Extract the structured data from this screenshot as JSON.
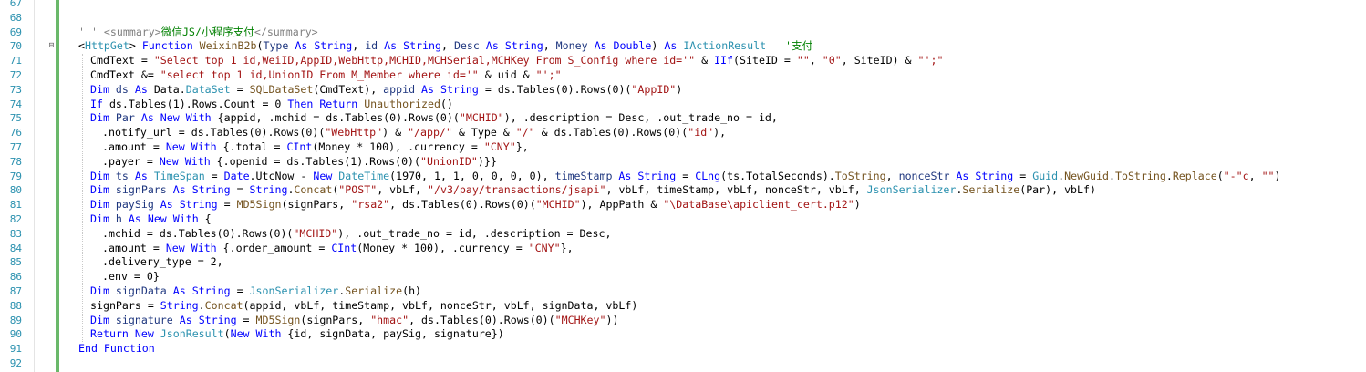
{
  "editor": {
    "colors": {
      "keyword": "#0000ff",
      "string": "#a31515",
      "type": "#2b91af",
      "comment": "#008000",
      "doc_comment": "#808080",
      "plain": "#000000",
      "method": "#74531f",
      "line_number": "#2b91af",
      "change_bar": "#6ab86a"
    },
    "fold_markers": [
      {
        "line": 70,
        "icon": "fold-collapse-icon",
        "glyph": "⊟"
      }
    ],
    "lines": [
      {
        "number": "67",
        "indent": 0,
        "tokens": []
      },
      {
        "number": "68",
        "indent": 0,
        "tokens": []
      },
      {
        "number": "69",
        "indent": 0,
        "tokens": [
          {
            "t": "''' ",
            "c": "doc"
          },
          {
            "t": "<summary>",
            "c": "doc"
          },
          {
            "t": "微信JS/小程序支付",
            "c": "cmt"
          },
          {
            "t": "</summary>",
            "c": "doc"
          }
        ]
      },
      {
        "number": "70",
        "indent": 0,
        "tokens": [
          {
            "t": "<",
            "c": "plain"
          },
          {
            "t": "HttpGet",
            "c": "type"
          },
          {
            "t": "> ",
            "c": "plain"
          },
          {
            "t": "Function ",
            "c": "kw"
          },
          {
            "t": "WeixinB2b",
            "c": "fn"
          },
          {
            "t": "(",
            "c": "plain"
          },
          {
            "t": "Type ",
            "c": "var"
          },
          {
            "t": "As ",
            "c": "kw"
          },
          {
            "t": "String",
            "c": "kw"
          },
          {
            "t": ", ",
            "c": "plain"
          },
          {
            "t": "id ",
            "c": "var"
          },
          {
            "t": "As ",
            "c": "kw"
          },
          {
            "t": "String",
            "c": "kw"
          },
          {
            "t": ", ",
            "c": "plain"
          },
          {
            "t": "Desc ",
            "c": "var"
          },
          {
            "t": "As ",
            "c": "kw"
          },
          {
            "t": "String",
            "c": "kw"
          },
          {
            "t": ", ",
            "c": "plain"
          },
          {
            "t": "Money ",
            "c": "var"
          },
          {
            "t": "As ",
            "c": "kw"
          },
          {
            "t": "Double",
            "c": "kw"
          },
          {
            "t": ") ",
            "c": "plain"
          },
          {
            "t": "As ",
            "c": "kw"
          },
          {
            "t": "IActionResult",
            "c": "type"
          },
          {
            "t": "   '支付",
            "c": "cmt"
          }
        ]
      },
      {
        "number": "71",
        "indent": 1,
        "tokens": [
          {
            "t": "CmdText = ",
            "c": "plain"
          },
          {
            "t": "\"Select top 1 id,WeiID,AppID,WebHttp,MCHID,MCHSerial,MCHKey From S_Config where id='\"",
            "c": "str"
          },
          {
            "t": " & ",
            "c": "plain"
          },
          {
            "t": "IIf",
            "c": "kw"
          },
          {
            "t": "(SiteID = ",
            "c": "plain"
          },
          {
            "t": "\"\"",
            "c": "str"
          },
          {
            "t": ", ",
            "c": "plain"
          },
          {
            "t": "\"0\"",
            "c": "str"
          },
          {
            "t": ", SiteID) & ",
            "c": "plain"
          },
          {
            "t": "\"';\"",
            "c": "str"
          }
        ]
      },
      {
        "number": "72",
        "indent": 1,
        "tokens": [
          {
            "t": "CmdText &= ",
            "c": "plain"
          },
          {
            "t": "\"select top 1 id,UnionID From M_Member where id='\"",
            "c": "str"
          },
          {
            "t": " & uid & ",
            "c": "plain"
          },
          {
            "t": "\"';\"",
            "c": "str"
          }
        ]
      },
      {
        "number": "73",
        "indent": 1,
        "tokens": [
          {
            "t": "Dim ",
            "c": "kw"
          },
          {
            "t": "ds ",
            "c": "var"
          },
          {
            "t": "As ",
            "c": "kw"
          },
          {
            "t": "Data",
            "c": "plain"
          },
          {
            "t": ".",
            "c": "plain"
          },
          {
            "t": "DataSet",
            "c": "type"
          },
          {
            "t": " = ",
            "c": "plain"
          },
          {
            "t": "SQLDataSet",
            "c": "fn"
          },
          {
            "t": "(CmdText), ",
            "c": "plain"
          },
          {
            "t": "appid ",
            "c": "var"
          },
          {
            "t": "As ",
            "c": "kw"
          },
          {
            "t": "String",
            "c": "kw"
          },
          {
            "t": " = ds.Tables(0).Rows(0)(",
            "c": "plain"
          },
          {
            "t": "\"AppID\"",
            "c": "str"
          },
          {
            "t": ")",
            "c": "plain"
          }
        ]
      },
      {
        "number": "74",
        "indent": 1,
        "tokens": [
          {
            "t": "If ",
            "c": "kw"
          },
          {
            "t": "ds.Tables(1).Rows.Count = 0 ",
            "c": "plain"
          },
          {
            "t": "Then ",
            "c": "kw"
          },
          {
            "t": "Return ",
            "c": "kw"
          },
          {
            "t": "Unauthorized",
            "c": "fn"
          },
          {
            "t": "()",
            "c": "plain"
          }
        ]
      },
      {
        "number": "75",
        "indent": 1,
        "tokens": [
          {
            "t": "Dim ",
            "c": "kw"
          },
          {
            "t": "Par ",
            "c": "var"
          },
          {
            "t": "As ",
            "c": "kw"
          },
          {
            "t": "New ",
            "c": "kw"
          },
          {
            "t": "With ",
            "c": "kw"
          },
          {
            "t": "{appid, .mchid = ds.Tables(0).Rows(0)(",
            "c": "plain"
          },
          {
            "t": "\"MCHID\"",
            "c": "str"
          },
          {
            "t": "), .description = Desc, .out_trade_no = id,",
            "c": "plain"
          }
        ]
      },
      {
        "number": "76",
        "indent": 2,
        "tokens": [
          {
            "t": ".notify_url = ds.Tables(0).Rows(0)(",
            "c": "plain"
          },
          {
            "t": "\"WebHttp\"",
            "c": "str"
          },
          {
            "t": ") & ",
            "c": "plain"
          },
          {
            "t": "\"/app/\"",
            "c": "str"
          },
          {
            "t": " & Type & ",
            "c": "plain"
          },
          {
            "t": "\"/\"",
            "c": "str"
          },
          {
            "t": " & ds.Tables(0).Rows(0)(",
            "c": "plain"
          },
          {
            "t": "\"id\"",
            "c": "str"
          },
          {
            "t": "),",
            "c": "plain"
          }
        ]
      },
      {
        "number": "77",
        "indent": 2,
        "tokens": [
          {
            "t": ".amount = ",
            "c": "plain"
          },
          {
            "t": "New ",
            "c": "kw"
          },
          {
            "t": "With ",
            "c": "kw"
          },
          {
            "t": "{.total = ",
            "c": "plain"
          },
          {
            "t": "CInt",
            "c": "kw"
          },
          {
            "t": "(Money * 100), .currency = ",
            "c": "plain"
          },
          {
            "t": "\"CNY\"",
            "c": "str"
          },
          {
            "t": "},",
            "c": "plain"
          }
        ]
      },
      {
        "number": "78",
        "indent": 2,
        "tokens": [
          {
            "t": ".payer = ",
            "c": "plain"
          },
          {
            "t": "New ",
            "c": "kw"
          },
          {
            "t": "With ",
            "c": "kw"
          },
          {
            "t": "{.openid = ds.Tables(1).Rows(0)(",
            "c": "plain"
          },
          {
            "t": "\"UnionID\"",
            "c": "str"
          },
          {
            "t": ")}}",
            "c": "plain"
          }
        ]
      },
      {
        "number": "79",
        "indent": 1,
        "tokens": [
          {
            "t": "Dim ",
            "c": "kw"
          },
          {
            "t": "ts ",
            "c": "var"
          },
          {
            "t": "As ",
            "c": "kw"
          },
          {
            "t": "TimeSpan",
            "c": "type"
          },
          {
            "t": " = ",
            "c": "plain"
          },
          {
            "t": "Date",
            "c": "kw"
          },
          {
            "t": ".UtcNow - ",
            "c": "plain"
          },
          {
            "t": "New ",
            "c": "kw"
          },
          {
            "t": "DateTime",
            "c": "type"
          },
          {
            "t": "(1970, 1, 1, 0, 0, 0, 0), ",
            "c": "plain"
          },
          {
            "t": "timeStamp ",
            "c": "var"
          },
          {
            "t": "As ",
            "c": "kw"
          },
          {
            "t": "String",
            "c": "kw"
          },
          {
            "t": " = ",
            "c": "plain"
          },
          {
            "t": "CLng",
            "c": "kw"
          },
          {
            "t": "(ts.TotalSeconds).",
            "c": "plain"
          },
          {
            "t": "ToString",
            "c": "fn"
          },
          {
            "t": ", ",
            "c": "plain"
          },
          {
            "t": "nonceStr ",
            "c": "var"
          },
          {
            "t": "As ",
            "c": "kw"
          },
          {
            "t": "String",
            "c": "kw"
          },
          {
            "t": " = ",
            "c": "plain"
          },
          {
            "t": "Guid",
            "c": "type"
          },
          {
            "t": ".",
            "c": "plain"
          },
          {
            "t": "NewGuid",
            "c": "fn"
          },
          {
            "t": ".",
            "c": "plain"
          },
          {
            "t": "ToString",
            "c": "fn"
          },
          {
            "t": ".",
            "c": "plain"
          },
          {
            "t": "Replace",
            "c": "fn"
          },
          {
            "t": "(",
            "c": "plain"
          },
          {
            "t": "\"-\"c",
            "c": "str"
          },
          {
            "t": ", ",
            "c": "plain"
          },
          {
            "t": "\"\"",
            "c": "str"
          },
          {
            "t": ")",
            "c": "plain"
          }
        ]
      },
      {
        "number": "80",
        "indent": 1,
        "tokens": [
          {
            "t": "Dim ",
            "c": "kw"
          },
          {
            "t": "signPars ",
            "c": "var"
          },
          {
            "t": "As ",
            "c": "kw"
          },
          {
            "t": "String",
            "c": "kw"
          },
          {
            "t": " = ",
            "c": "plain"
          },
          {
            "t": "String",
            "c": "kw"
          },
          {
            "t": ".",
            "c": "plain"
          },
          {
            "t": "Concat",
            "c": "fn"
          },
          {
            "t": "(",
            "c": "plain"
          },
          {
            "t": "\"POST\"",
            "c": "str"
          },
          {
            "t": ", vbLf, ",
            "c": "plain"
          },
          {
            "t": "\"/v3/pay/transactions/jsapi\"",
            "c": "str"
          },
          {
            "t": ", vbLf, timeStamp, vbLf, nonceStr, vbLf, ",
            "c": "plain"
          },
          {
            "t": "JsonSerializer",
            "c": "type"
          },
          {
            "t": ".",
            "c": "plain"
          },
          {
            "t": "Serialize",
            "c": "fn"
          },
          {
            "t": "(Par), vbLf)",
            "c": "plain"
          }
        ]
      },
      {
        "number": "81",
        "indent": 1,
        "tokens": [
          {
            "t": "Dim ",
            "c": "kw"
          },
          {
            "t": "paySig ",
            "c": "var"
          },
          {
            "t": "As ",
            "c": "kw"
          },
          {
            "t": "String",
            "c": "kw"
          },
          {
            "t": " = ",
            "c": "plain"
          },
          {
            "t": "MD5Sign",
            "c": "fn"
          },
          {
            "t": "(signPars, ",
            "c": "plain"
          },
          {
            "t": "\"rsa2\"",
            "c": "str"
          },
          {
            "t": ", ds.Tables(0).Rows(0)(",
            "c": "plain"
          },
          {
            "t": "\"MCHID\"",
            "c": "str"
          },
          {
            "t": "), AppPath & ",
            "c": "plain"
          },
          {
            "t": "\"\\DataBase\\apiclient_cert.p12\"",
            "c": "str"
          },
          {
            "t": ")",
            "c": "plain"
          }
        ]
      },
      {
        "number": "82",
        "indent": 1,
        "tokens": [
          {
            "t": "Dim ",
            "c": "kw"
          },
          {
            "t": "h ",
            "c": "var"
          },
          {
            "t": "As ",
            "c": "kw"
          },
          {
            "t": "New ",
            "c": "kw"
          },
          {
            "t": "With ",
            "c": "kw"
          },
          {
            "t": "{",
            "c": "plain"
          }
        ]
      },
      {
        "number": "83",
        "indent": 2,
        "tokens": [
          {
            "t": ".mchid = ds.Tables(0).Rows(0)(",
            "c": "plain"
          },
          {
            "t": "\"MCHID\"",
            "c": "str"
          },
          {
            "t": "), .out_trade_no = id, .description = Desc,",
            "c": "plain"
          }
        ]
      },
      {
        "number": "84",
        "indent": 2,
        "tokens": [
          {
            "t": ".amount = ",
            "c": "plain"
          },
          {
            "t": "New ",
            "c": "kw"
          },
          {
            "t": "With ",
            "c": "kw"
          },
          {
            "t": "{.order_amount = ",
            "c": "plain"
          },
          {
            "t": "CInt",
            "c": "kw"
          },
          {
            "t": "(Money * 100), .currency = ",
            "c": "plain"
          },
          {
            "t": "\"CNY\"",
            "c": "str"
          },
          {
            "t": "},",
            "c": "plain"
          }
        ]
      },
      {
        "number": "85",
        "indent": 2,
        "tokens": [
          {
            "t": ".delivery_type = 2,",
            "c": "plain"
          }
        ]
      },
      {
        "number": "86",
        "indent": 2,
        "tokens": [
          {
            "t": ".env = 0}",
            "c": "plain"
          }
        ]
      },
      {
        "number": "87",
        "indent": 1,
        "tokens": [
          {
            "t": "Dim ",
            "c": "kw"
          },
          {
            "t": "signData ",
            "c": "var"
          },
          {
            "t": "As ",
            "c": "kw"
          },
          {
            "t": "String",
            "c": "kw"
          },
          {
            "t": " = ",
            "c": "plain"
          },
          {
            "t": "JsonSerializer",
            "c": "type"
          },
          {
            "t": ".",
            "c": "plain"
          },
          {
            "t": "Serialize",
            "c": "fn"
          },
          {
            "t": "(h)",
            "c": "plain"
          }
        ]
      },
      {
        "number": "88",
        "indent": 1,
        "tokens": [
          {
            "t": "signPars = ",
            "c": "plain"
          },
          {
            "t": "String",
            "c": "kw"
          },
          {
            "t": ".",
            "c": "plain"
          },
          {
            "t": "Concat",
            "c": "fn"
          },
          {
            "t": "(appid, vbLf, timeStamp, vbLf, nonceStr, vbLf, signData, vbLf)",
            "c": "plain"
          }
        ]
      },
      {
        "number": "89",
        "indent": 1,
        "tokens": [
          {
            "t": "Dim ",
            "c": "kw"
          },
          {
            "t": "signature ",
            "c": "var"
          },
          {
            "t": "As ",
            "c": "kw"
          },
          {
            "t": "String",
            "c": "kw"
          },
          {
            "t": " = ",
            "c": "plain"
          },
          {
            "t": "MD5Sign",
            "c": "fn"
          },
          {
            "t": "(signPars, ",
            "c": "plain"
          },
          {
            "t": "\"hmac\"",
            "c": "str"
          },
          {
            "t": ", ds.Tables(0).Rows(0)(",
            "c": "plain"
          },
          {
            "t": "\"MCHKey\"",
            "c": "str"
          },
          {
            "t": "))",
            "c": "plain"
          }
        ]
      },
      {
        "number": "90",
        "indent": 1,
        "tokens": [
          {
            "t": "Return ",
            "c": "kw"
          },
          {
            "t": "New ",
            "c": "kw"
          },
          {
            "t": "JsonResult",
            "c": "type"
          },
          {
            "t": "(",
            "c": "plain"
          },
          {
            "t": "New ",
            "c": "kw"
          },
          {
            "t": "With ",
            "c": "kw"
          },
          {
            "t": "{id, signData, paySig, signature})",
            "c": "plain"
          }
        ]
      },
      {
        "number": "91",
        "indent": 0,
        "tokens": [
          {
            "t": "End ",
            "c": "kw"
          },
          {
            "t": "Function",
            "c": "kw"
          }
        ]
      },
      {
        "number": "92",
        "indent": 0,
        "tokens": []
      }
    ]
  }
}
